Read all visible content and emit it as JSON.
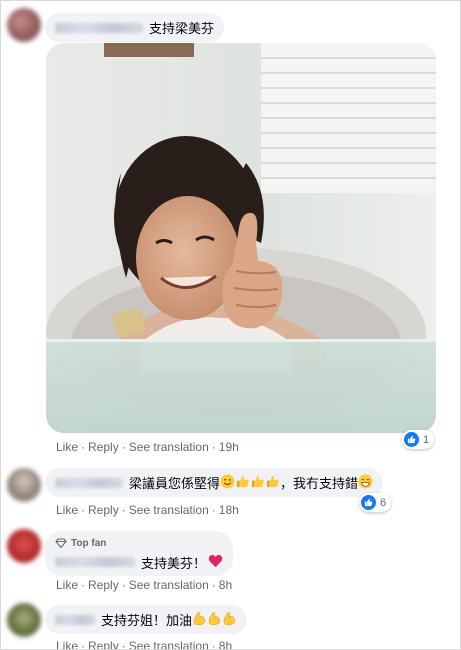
{
  "comments": [
    {
      "text": "支持梁美芬"
    },
    {
      "actions": {
        "like": "Like",
        "reply": "Reply",
        "translate": "See translation",
        "time": "19h"
      },
      "reaction_count": "1"
    },
    {
      "text": "梁議員您係堅得",
      "text_after": "，我冇支持錯",
      "actions": {
        "like": "Like",
        "reply": "Reply",
        "translate": "See translation",
        "time": "18h"
      },
      "reaction_count": "6"
    },
    {
      "badge": "Top fan",
      "text": "支持美芬！",
      "actions": {
        "like": "Like",
        "reply": "Reply",
        "translate": "See translation",
        "time": "8h"
      }
    },
    {
      "text": "支持芬姐！加油",
      "actions": {
        "like": "Like",
        "reply": "Reply",
        "translate": "See translation",
        "time": "8h"
      }
    }
  ],
  "separator": "·",
  "icons": [
    "like-icon",
    "diamond-icon",
    "wink-emoji",
    "thumbs-up-emoji",
    "grin-emoji",
    "heart-emoji",
    "flexed-biceps-emoji"
  ],
  "colors": {
    "link_gray": "#65676b",
    "bubble_bg": "#f0f2f5",
    "like_blue": "#1877f2",
    "heart_red": "#e0245e"
  }
}
